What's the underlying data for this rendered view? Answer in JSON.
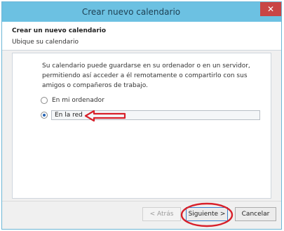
{
  "window": {
    "title": "Crear nuevo calendario",
    "close_glyph": "✕"
  },
  "header": {
    "step_title": "Crear un nuevo calendario",
    "step_subtitle": "Ubique su calendario"
  },
  "content": {
    "description": "Su calendario puede guardarse en su ordenador o en un servidor, permitiendo así acceder a él remotamente o compartirlo con sus amigos o compañeros de trabajo.",
    "options": [
      {
        "label": "En mi ordenador",
        "checked": false
      },
      {
        "label": "En la red",
        "checked": true
      }
    ]
  },
  "buttons": {
    "back": "< Atrás",
    "next": "Siguiente >",
    "cancel": "Cancelar"
  },
  "colors": {
    "titlebar": "#6cc1e2",
    "close": "#c94545",
    "annotation": "#d8202a"
  }
}
